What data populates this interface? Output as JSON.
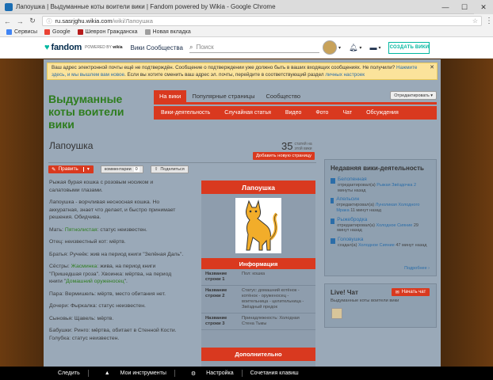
{
  "browser": {
    "tab_title": "Лапоушка | Выдуманные коты воители вики | Fandom powered by Wikia - Google Chrome",
    "url_domain": "ru.sasrjghu.wikia.com",
    "url_path": "/wiki/Лапоушка",
    "bookmarks": [
      {
        "label": "Сервисы",
        "color": "#4285f4"
      },
      {
        "label": "Google",
        "color": "#ea4335"
      },
      {
        "label": "Шеврон Гражданска",
        "color": "#b71c1c"
      },
      {
        "label": "Новая вкладка",
        "color": "#9e9e9e"
      }
    ]
  },
  "fandom_bar": {
    "logo": "fandom",
    "powered_by": "POWERED BY",
    "wikia": "wikia",
    "communities": "Вики Сообщества",
    "search_placeholder": "Поиск",
    "create_wiki": "СОЗДАТЬ ВИКИ"
  },
  "notice": {
    "text": "Ваш адрес электронной почты ещё не подтверждён. Сообщение о подтверждении уже должно быть в ваших входящих сообщениях. Не получили?",
    "link1": "Нажмите здесь, и мы вышлем вам новое",
    "text2": ". Если вы хотите сменить ваш адрес эл. почты, перейдите в соответствующий раздел",
    "link2": "личных настроек",
    "close": "✕"
  },
  "wiki": {
    "title": "Выдуманные коты воители вики",
    "tabs": [
      "На вики",
      "Популярные страницы",
      "Сообщество"
    ],
    "tab_dropdown": "Отредактировать ▾",
    "subnav": [
      "Вики-деятельность",
      "Случайная статья",
      "Видео",
      "Фото",
      "Чат",
      "Обсуждения"
    ]
  },
  "page": {
    "title": "Лапоушка",
    "article_count": "35",
    "article_count_label": "статей на этой вики",
    "add_page": "Добавить новую страницу",
    "edit": "Править",
    "comments": "комментарии",
    "comments_count": "0",
    "share": "Поделиться"
  },
  "article": {
    "p1": "Рыжая бурая кошка с розовым носиком и салатовыми глазами.",
    "p2": "Лапоушка - ворчливая несносная кошка. Но аккуратная, знает что делает, и быстро принимает решения. Обидчива.",
    "p3a": "Мать: ",
    "p3b": "Пятнолистая",
    "p3c": ": статус неизвестен.",
    "p4": "Отец: неизвестный кот: мёртв.",
    "p5": "Братья: Ручеёк: жив на период книги \"Зелёная Даль\".",
    "p6a": "Сёстры: ",
    "p6b": "Жасминка",
    "p6c": ": жива, на период книги \"Пришедшая гроза\". Хвоинка: мёртва, на период книги \"",
    "p6d": "Домашний оруженосец",
    "p6e": "\".",
    "p7": "Пара: Вермишель: мёртв, место обитания нет.",
    "p8": "Дочери: Фыркалка: статус неизвестен.",
    "p9": "Сыновья: Щавель: мёртв.",
    "p10": "Бабушки: Ринго: мёртва, обитает в Стенной Кости. Голубка: статус неизвестен."
  },
  "infobox": {
    "title": "Лапоушка",
    "section_info": "Информация",
    "rows": [
      {
        "key": "Название строки 1",
        "value": "Пол: кошка"
      },
      {
        "key": "Название строки 2",
        "value": "Статус: домашний котёнок - котёнок - оруженосец - воительница - целительница - Звёздный предок"
      },
      {
        "key": "Название строки 3",
        "value": "Принадлежность: Холодная Стена Тьмы"
      }
    ],
    "section_extra": "Дополнительно"
  },
  "activity": {
    "title": "Недавняя вики-деятельность",
    "items": [
      {
        "page": "Белопенная",
        "user": "Рыжая Звёздочка 2",
        "ago": "минуты назад",
        "prefix": "отредактировал(а)"
      },
      {
        "page": "Апельсин",
        "user": "Луноликая Холодного Мрака",
        "ago": "11 минут назад",
        "prefix": "отредактировал(а)"
      },
      {
        "page": "Рыжебродка",
        "user": "Холодное Сияние",
        "ago": "29 минут назад",
        "prefix": "отредактировал(а)"
      },
      {
        "page": "Головушка",
        "user": "Холодное Сияние",
        "ago": "47 минут назад",
        "prefix": "создал(а)"
      }
    ],
    "more": "Подробнее ›"
  },
  "chat": {
    "title": "Live! Чат",
    "subtitle": "Выдуманные коты воители вики",
    "button": "Начать чат"
  },
  "toolbar": [
    "Следить",
    "Мои инструменты",
    "Настройка",
    "Сочетания клавиш"
  ]
}
